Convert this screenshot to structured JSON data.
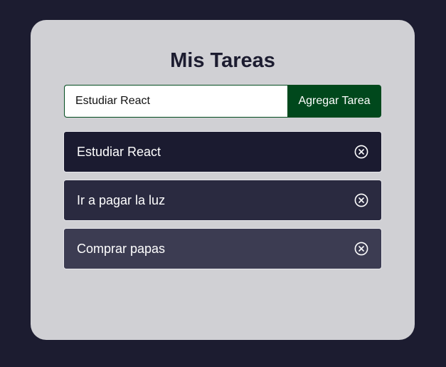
{
  "header": {
    "title": "Mis Tareas"
  },
  "form": {
    "input_value": "Estudiar React",
    "add_label": "Agregar Tarea"
  },
  "tasks": [
    {
      "text": "Estudiar React",
      "delete_icon": "close-circle-icon"
    },
    {
      "text": "Ir a pagar la luz",
      "delete_icon": "close-circle-icon"
    },
    {
      "text": "Comprar papas",
      "delete_icon": "close-circle-icon"
    }
  ],
  "colors": {
    "page_background": "#1c1c30",
    "card_background": "#d0d0d4",
    "accent": "#00481c",
    "task_backgrounds": [
      "#1b1b30",
      "#2a2a40",
      "#3c3c52"
    ],
    "task_text": "#ffffff"
  }
}
